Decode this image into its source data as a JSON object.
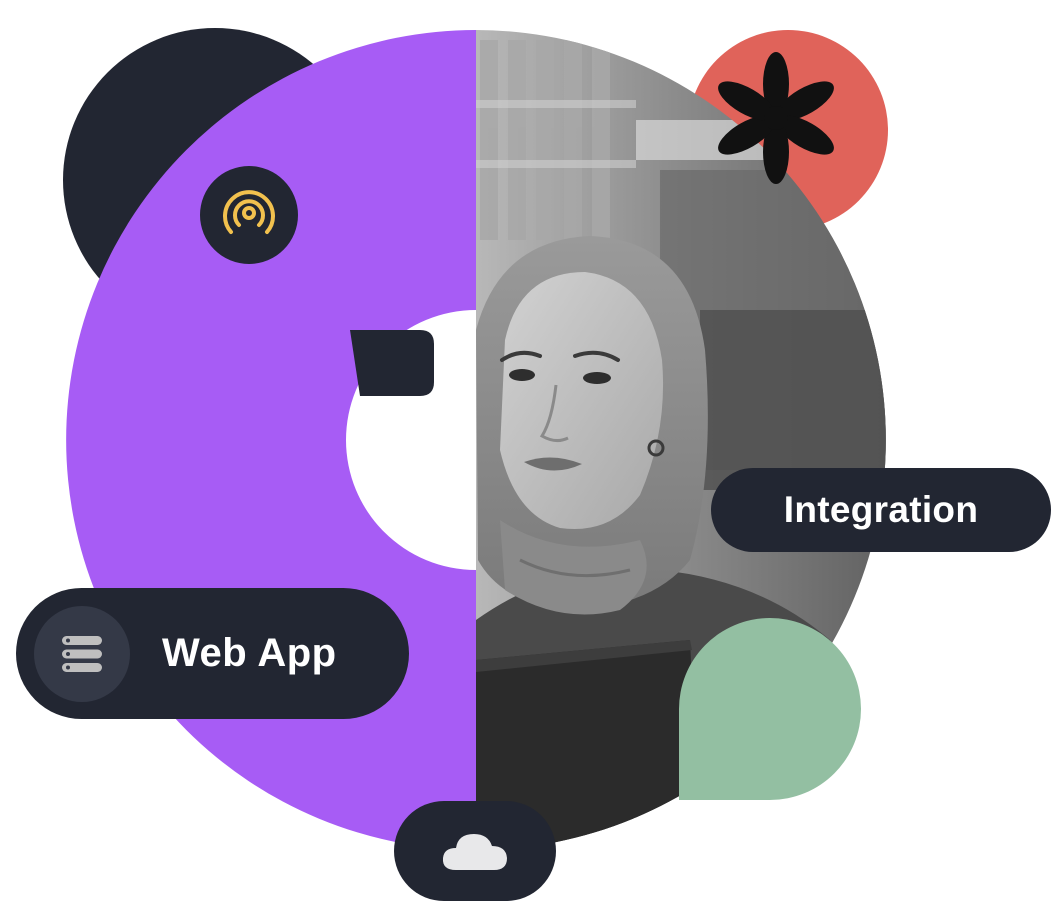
{
  "labels": {
    "web_app": "Web App",
    "integration": "Integration"
  },
  "icons": {
    "signal": "broadcast-signal-icon",
    "server": "server-stack-icon",
    "cloud": "cloud-icon",
    "asterisk": "asterisk-icon"
  },
  "colors": {
    "purple": "#A75CF5",
    "dark_navy": "#222632",
    "coral": "#E0635A",
    "mint": "#93BFA2",
    "gold": "#F2C14E",
    "white": "#FFFFFF"
  }
}
